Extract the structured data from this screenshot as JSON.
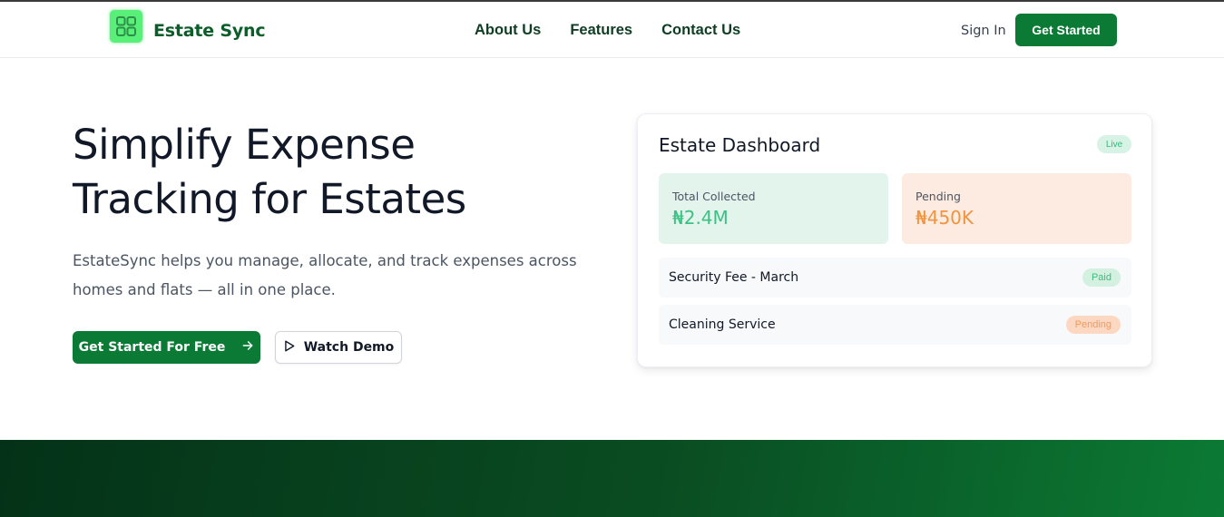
{
  "header": {
    "brand": "Estate Sync",
    "nav": [
      "About Us",
      "Features",
      "Contact Us"
    ],
    "sign_in": "Sign In",
    "get_started": "Get Started"
  },
  "hero": {
    "title_line1": "Simplify Expense",
    "title_line2": "Tracking for Estates",
    "subtitle_line1": "EstateSync helps you manage, allocate, and track expenses across",
    "subtitle_line2": "homes and flats — all in one place.",
    "primary_cta": "Get Started For Free",
    "secondary_cta": "Watch Demo"
  },
  "dashboard": {
    "title": "Estate Dashboard",
    "live_badge": "Live",
    "stats": [
      {
        "label": "Total Collected",
        "value": "₦2.4M"
      },
      {
        "label": "Pending",
        "value": "₦450K"
      }
    ],
    "items": [
      {
        "label": "Security Fee - March",
        "status": "Paid"
      },
      {
        "label": "Cleaning Service",
        "status": "Pending"
      }
    ]
  },
  "colors": {
    "brand_green": "#0b7a34",
    "logo_green": "#59f07a",
    "paid_green": "#3cbc7e",
    "pending_orange": "#f39a58"
  },
  "icons": {
    "logo": "grid-icon",
    "primary_cta": "arrow-right-icon",
    "secondary_cta": "play-icon"
  }
}
